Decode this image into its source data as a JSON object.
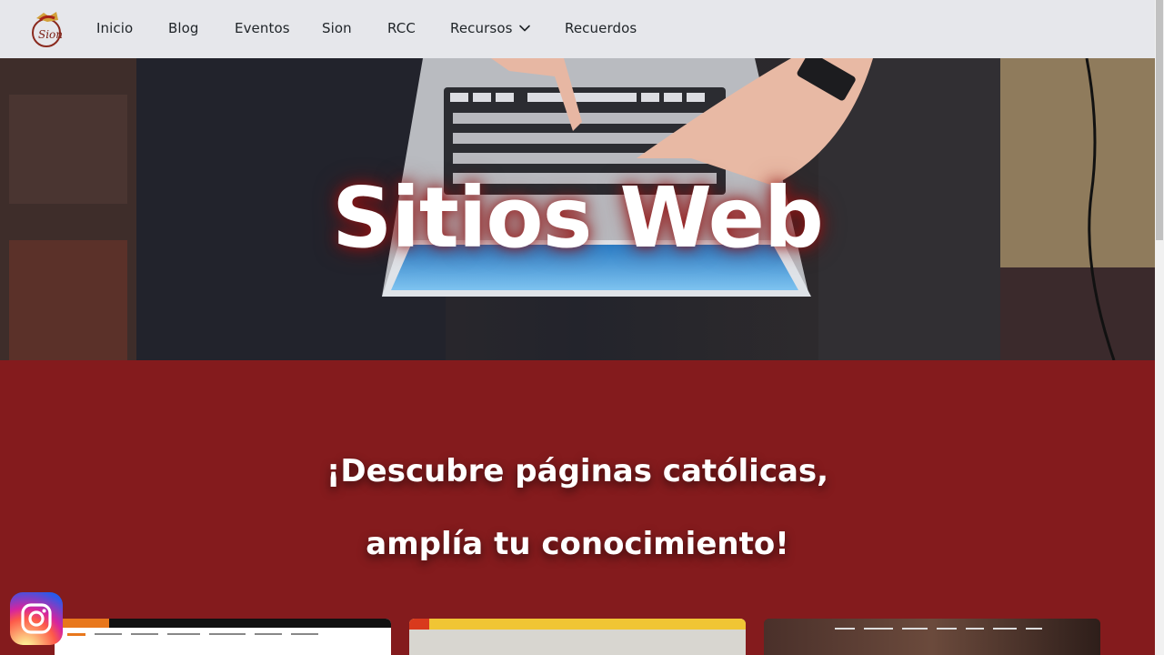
{
  "nav": {
    "items": [
      {
        "label": "Inicio"
      },
      {
        "label": "Blog"
      },
      {
        "label": "Eventos"
      },
      {
        "label": "Sion"
      },
      {
        "label": "RCC"
      },
      {
        "label": "Recursos"
      },
      {
        "label": "Recuerdos"
      }
    ]
  },
  "hero": {
    "title": "Sitios Web"
  },
  "section": {
    "line1": "¡Descubre páginas católicas,",
    "line2": "amplía tu conocimiento!"
  },
  "cards": [
    {
      "name": "card-1"
    },
    {
      "name": "card-2"
    },
    {
      "name": "card-3"
    }
  ],
  "colors": {
    "nav_bg": "#e6e7eb",
    "section_bg": "#841b1d",
    "hero_text": "#ffffff"
  },
  "icons": {
    "logo": "sion-logo-icon",
    "dropdown": "chevron-down-icon",
    "social": "instagram-icon"
  }
}
